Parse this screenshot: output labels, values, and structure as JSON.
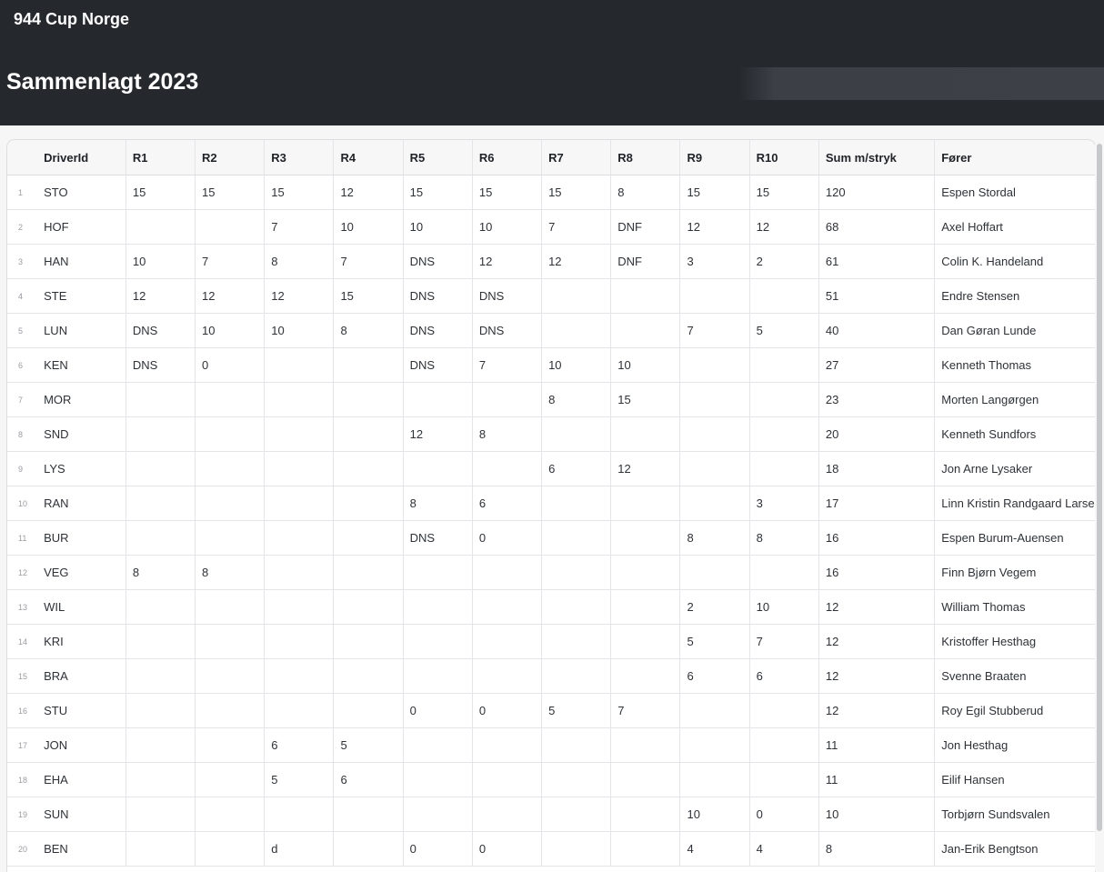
{
  "site": {
    "title": "944 Cup Norge"
  },
  "page": {
    "title": "Sammenlagt 2023"
  },
  "table": {
    "columns": [
      "DriverId",
      "R1",
      "R2",
      "R3",
      "R4",
      "R5",
      "R6",
      "R7",
      "R8",
      "R9",
      "R10",
      "Sum m/stryk",
      "Fører"
    ],
    "rows": [
      [
        "1",
        "STO",
        "15",
        "15",
        "15",
        "12",
        "15",
        "15",
        "15",
        "8",
        "15",
        "15",
        "120",
        "Espen Stordal"
      ],
      [
        "2",
        "HOF",
        "",
        "",
        "7",
        "10",
        "10",
        "10",
        "7",
        "DNF",
        "12",
        "12",
        "68",
        "Axel Hoffart"
      ],
      [
        "3",
        "HAN",
        "10",
        "7",
        "8",
        "7",
        "DNS",
        "12",
        "12",
        "DNF",
        "3",
        "2",
        "61",
        "Colin K. Handeland"
      ],
      [
        "4",
        "STE",
        "12",
        "12",
        "12",
        "15",
        "DNS",
        "DNS",
        "",
        "",
        "",
        "",
        "51",
        "Endre Stensen"
      ],
      [
        "5",
        "LUN",
        "DNS",
        "10",
        "10",
        "8",
        "DNS",
        "DNS",
        "",
        "",
        "7",
        "5",
        "40",
        "Dan Gøran Lunde"
      ],
      [
        "6",
        "KEN",
        "DNS",
        "0",
        "",
        "",
        "DNS",
        "7",
        "10",
        "10",
        "",
        "",
        "27",
        "Kenneth Thomas"
      ],
      [
        "7",
        "MOR",
        "",
        "",
        "",
        "",
        "",
        "",
        "8",
        "15",
        "",
        "",
        "23",
        "Morten Langørgen"
      ],
      [
        "8",
        "SND",
        "",
        "",
        "",
        "",
        "12",
        "8",
        "",
        "",
        "",
        "",
        "20",
        "Kenneth Sundfors"
      ],
      [
        "9",
        "LYS",
        "",
        "",
        "",
        "",
        "",
        "",
        "6",
        "12",
        "",
        "",
        "18",
        "Jon Arne Lysaker"
      ],
      [
        "10",
        "RAN",
        "",
        "",
        "",
        "",
        "8",
        "6",
        "",
        "",
        "",
        "3",
        "17",
        "Linn Kristin Randgaard Larsen"
      ],
      [
        "11",
        "BUR",
        "",
        "",
        "",
        "",
        "DNS",
        "0",
        "",
        "",
        "8",
        "8",
        "16",
        "Espen Burum-Auensen"
      ],
      [
        "12",
        "VEG",
        "8",
        "8",
        "",
        "",
        "",
        "",
        "",
        "",
        "",
        "",
        "16",
        "Finn Bjørn Vegem"
      ],
      [
        "13",
        "WIL",
        "",
        "",
        "",
        "",
        "",
        "",
        "",
        "",
        "2",
        "10",
        "12",
        "William Thomas"
      ],
      [
        "14",
        "KRI",
        "",
        "",
        "",
        "",
        "",
        "",
        "",
        "",
        "5",
        "7",
        "12",
        "Kristoffer Hesthag"
      ],
      [
        "15",
        "BRA",
        "",
        "",
        "",
        "",
        "",
        "",
        "",
        "",
        "6",
        "6",
        "12",
        "Svenne Braaten"
      ],
      [
        "16",
        "STU",
        "",
        "",
        "",
        "",
        "0",
        "0",
        "5",
        "7",
        "",
        "",
        "12",
        "Roy Egil Stubberud"
      ],
      [
        "17",
        "JON",
        "",
        "",
        "6",
        "5",
        "",
        "",
        "",
        "",
        "",
        "",
        "11",
        "Jon Hesthag"
      ],
      [
        "18",
        "EHA",
        "",
        "",
        "5",
        "6",
        "",
        "",
        "",
        "",
        "",
        "",
        "11",
        "Eilif Hansen"
      ],
      [
        "19",
        "SUN",
        "",
        "",
        "",
        "",
        "",
        "",
        "",
        "",
        "10",
        "0",
        "10",
        "Torbjørn Sundsvalen"
      ],
      [
        "20",
        "BEN",
        "",
        "",
        "d",
        "",
        "0",
        "0",
        "",
        "",
        "4",
        "4",
        "8",
        "Jan-Erik Bengtson"
      ]
    ]
  }
}
